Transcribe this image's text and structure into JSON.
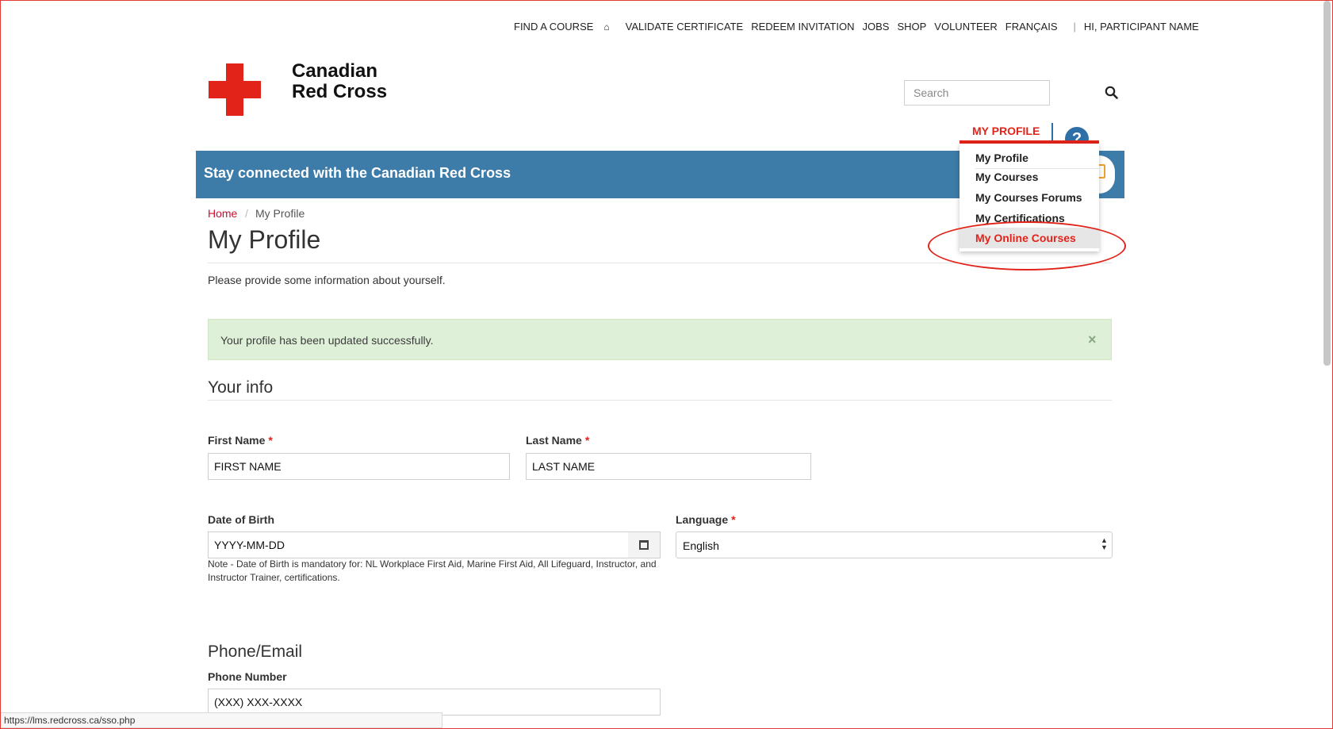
{
  "topnav": {
    "find_course": "FIND A COURSE",
    "validate": "VALIDATE CERTIFICATE",
    "redeem": "REDEEM INVITATION",
    "jobs": "JOBS",
    "shop": "SHOP",
    "volunteer": "VOLUNTEER",
    "francais": "FRANÇAIS",
    "separator": "|",
    "greeting": "HI, PARTICIPANT NAME"
  },
  "logo": {
    "line1": "Canadian",
    "line2": "Red Cross"
  },
  "search": {
    "placeholder": "Search"
  },
  "profile_menu": {
    "tab_label": "MY PROFILE",
    "help_glyph": "?",
    "items": [
      {
        "label": "My Profile"
      },
      {
        "label": "My Courses"
      },
      {
        "label": "My Courses Forums"
      },
      {
        "label": "My Certifications"
      },
      {
        "label": "My Online Courses"
      }
    ]
  },
  "banner": {
    "text": "Stay connected with the Canadian Red Cross"
  },
  "breadcrumb": {
    "home": "Home",
    "sep": "/",
    "current": "My Profile"
  },
  "page": {
    "title": "My Profile",
    "intro": "Please provide some information about yourself."
  },
  "alert": {
    "text": "Your profile has been updated successfully.",
    "close": "×"
  },
  "your_info": {
    "title": "Your info",
    "first_name": {
      "label": "First Name",
      "value": "FIRST NAME"
    },
    "last_name": {
      "label": "Last Name",
      "value": "LAST NAME"
    },
    "dob": {
      "label": "Date of Birth",
      "value": "YYYY-MM-DD",
      "note": "Note - Date of Birth is mandatory for: NL Workplace First Aid, Marine First Aid, All Lifeguard, Instructor, and Instructor Trainer, certifications."
    },
    "language": {
      "label": "Language",
      "value": "English"
    },
    "required_mark": "*"
  },
  "phone_email": {
    "title": "Phone/Email",
    "phone": {
      "label": "Phone Number",
      "value": "(XXX) XXX-XXXX"
    }
  },
  "status_bar": {
    "url": "https://lms.redcross.ca/sso.php"
  },
  "colors": {
    "brand_red": "#e2231a",
    "banner_blue": "#3d7ca9",
    "success_bg": "#dff0d8"
  }
}
